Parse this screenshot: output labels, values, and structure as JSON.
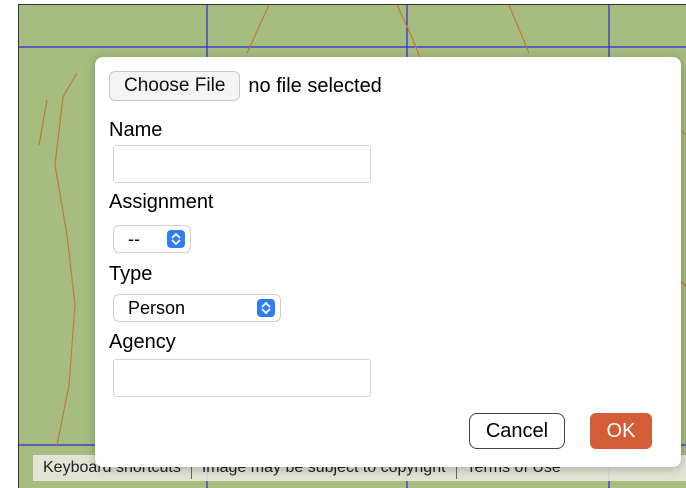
{
  "dialog": {
    "file_button_label": "Choose File",
    "file_status": "no file selected",
    "name_label": "Name",
    "name_value": "",
    "assignment_label": "Assignment",
    "assignment_selected": "--",
    "type_label": "Type",
    "type_selected": "Person",
    "agency_label": "Agency",
    "agency_value": "",
    "cancel_label": "Cancel",
    "ok_label": "OK"
  },
  "map_footer": {
    "keyboard_shortcuts": "Keyboard shortcuts",
    "copyright": "Image may be subject to copyright",
    "terms": "Terms of Use"
  },
  "colors": {
    "map_background": "#a6bd7f",
    "select_arrow": "#2f7cf6",
    "ok_button": "#d35d36",
    "grid_lines": "#2b2bd9",
    "contour_lines": "#c07a3a"
  }
}
